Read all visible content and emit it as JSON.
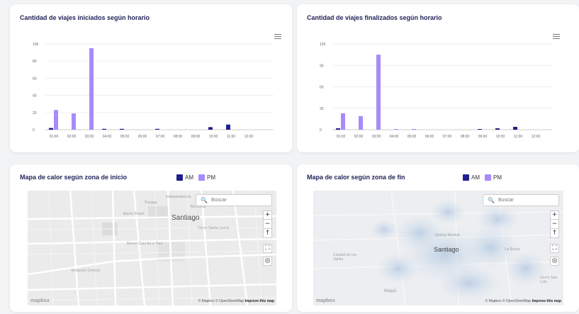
{
  "charts": {
    "start": {
      "title": "Cantidad de viajes iniciados según horario",
      "yticks": [
        "100",
        "80",
        "60",
        "40",
        "20",
        "0"
      ]
    },
    "end": {
      "title": "Cantidad de viajes finalizados según horario",
      "yticks": [
        "120",
        "90",
        "60",
        "30",
        "0"
      ]
    }
  },
  "chart_data": [
    {
      "type": "bar",
      "categories": [
        "01:00",
        "02:00",
        "03:00",
        "04:00",
        "05:00",
        "06:00",
        "07:00",
        "08:00",
        "09:00",
        "10:00",
        "11:00",
        "12:00"
      ],
      "series": [
        {
          "name": "AM",
          "color": "#1f1f8f",
          "values": [
            2,
            0,
            0,
            1,
            1,
            0,
            1,
            0,
            0,
            3,
            6,
            0
          ]
        },
        {
          "name": "PM",
          "color": "#a78bfa",
          "values": [
            23,
            19,
            95,
            0,
            0,
            0,
            0,
            0,
            0,
            0,
            0,
            0
          ]
        }
      ],
      "ylim": [
        0,
        100
      ],
      "yticks": [
        0,
        20,
        40,
        60,
        80,
        100
      ],
      "title": "Cantidad de viajes iniciados según horario",
      "grid": true
    },
    {
      "type": "bar",
      "categories": [
        "01:00",
        "02:00",
        "03:00",
        "04:00",
        "05:00",
        "06:00",
        "07:00",
        "08:00",
        "09:00",
        "10:00",
        "11:00",
        "12:00"
      ],
      "series": [
        {
          "name": "AM",
          "color": "#1f1f8f",
          "values": [
            2,
            0,
            0,
            0,
            0,
            0,
            0,
            0,
            1,
            2,
            4,
            0
          ]
        },
        {
          "name": "PM",
          "color": "#a78bfa",
          "values": [
            23,
            19,
            105,
            1,
            1,
            0,
            0,
            0,
            0,
            0,
            0,
            0
          ]
        }
      ],
      "ylim": [
        0,
        120
      ],
      "yticks": [
        0,
        30,
        60,
        90,
        120
      ],
      "title": "Cantidad de viajes finalizados según horario",
      "grid": true
    }
  ],
  "maps": {
    "start": {
      "title": "Mapa de calor según zona de inicio",
      "search_placeholder": "Buscar",
      "city_label": "Santiago",
      "places": [
        "Yungay",
        "Barrio Brasil",
        "Barrio Concha y Toro",
        "Estación Central",
        "Cerro Santa Lucía",
        "Recoleta",
        "Independencia"
      ],
      "logo": "mapbox",
      "attribution": "© Mapbox © OpenStreetMap",
      "improve": "Improve this map"
    },
    "end": {
      "title": "Mapa de calor según zona de fin",
      "search_placeholder": "Buscar",
      "city_label": "Santiago",
      "places": [
        "Ciudad de los Valles",
        "Maipú",
        "La Reina",
        "Cerro San Luis",
        "Quinta Normal"
      ],
      "logo": "mapbox",
      "attribution": "© Mapbox © OpenStreetMap",
      "improve": "Improve this map"
    }
  },
  "legend": {
    "am": "AM",
    "pm": "PM",
    "am_color": "#1f1f8f",
    "pm_color": "#a78bfa"
  },
  "controls": {
    "zoom_in": "+",
    "zoom_out": "−",
    "compass": "↑",
    "fullscreen": "⛶",
    "locate": "◎"
  },
  "icons": {
    "menu": "hamburger-icon",
    "search": "search-icon"
  }
}
